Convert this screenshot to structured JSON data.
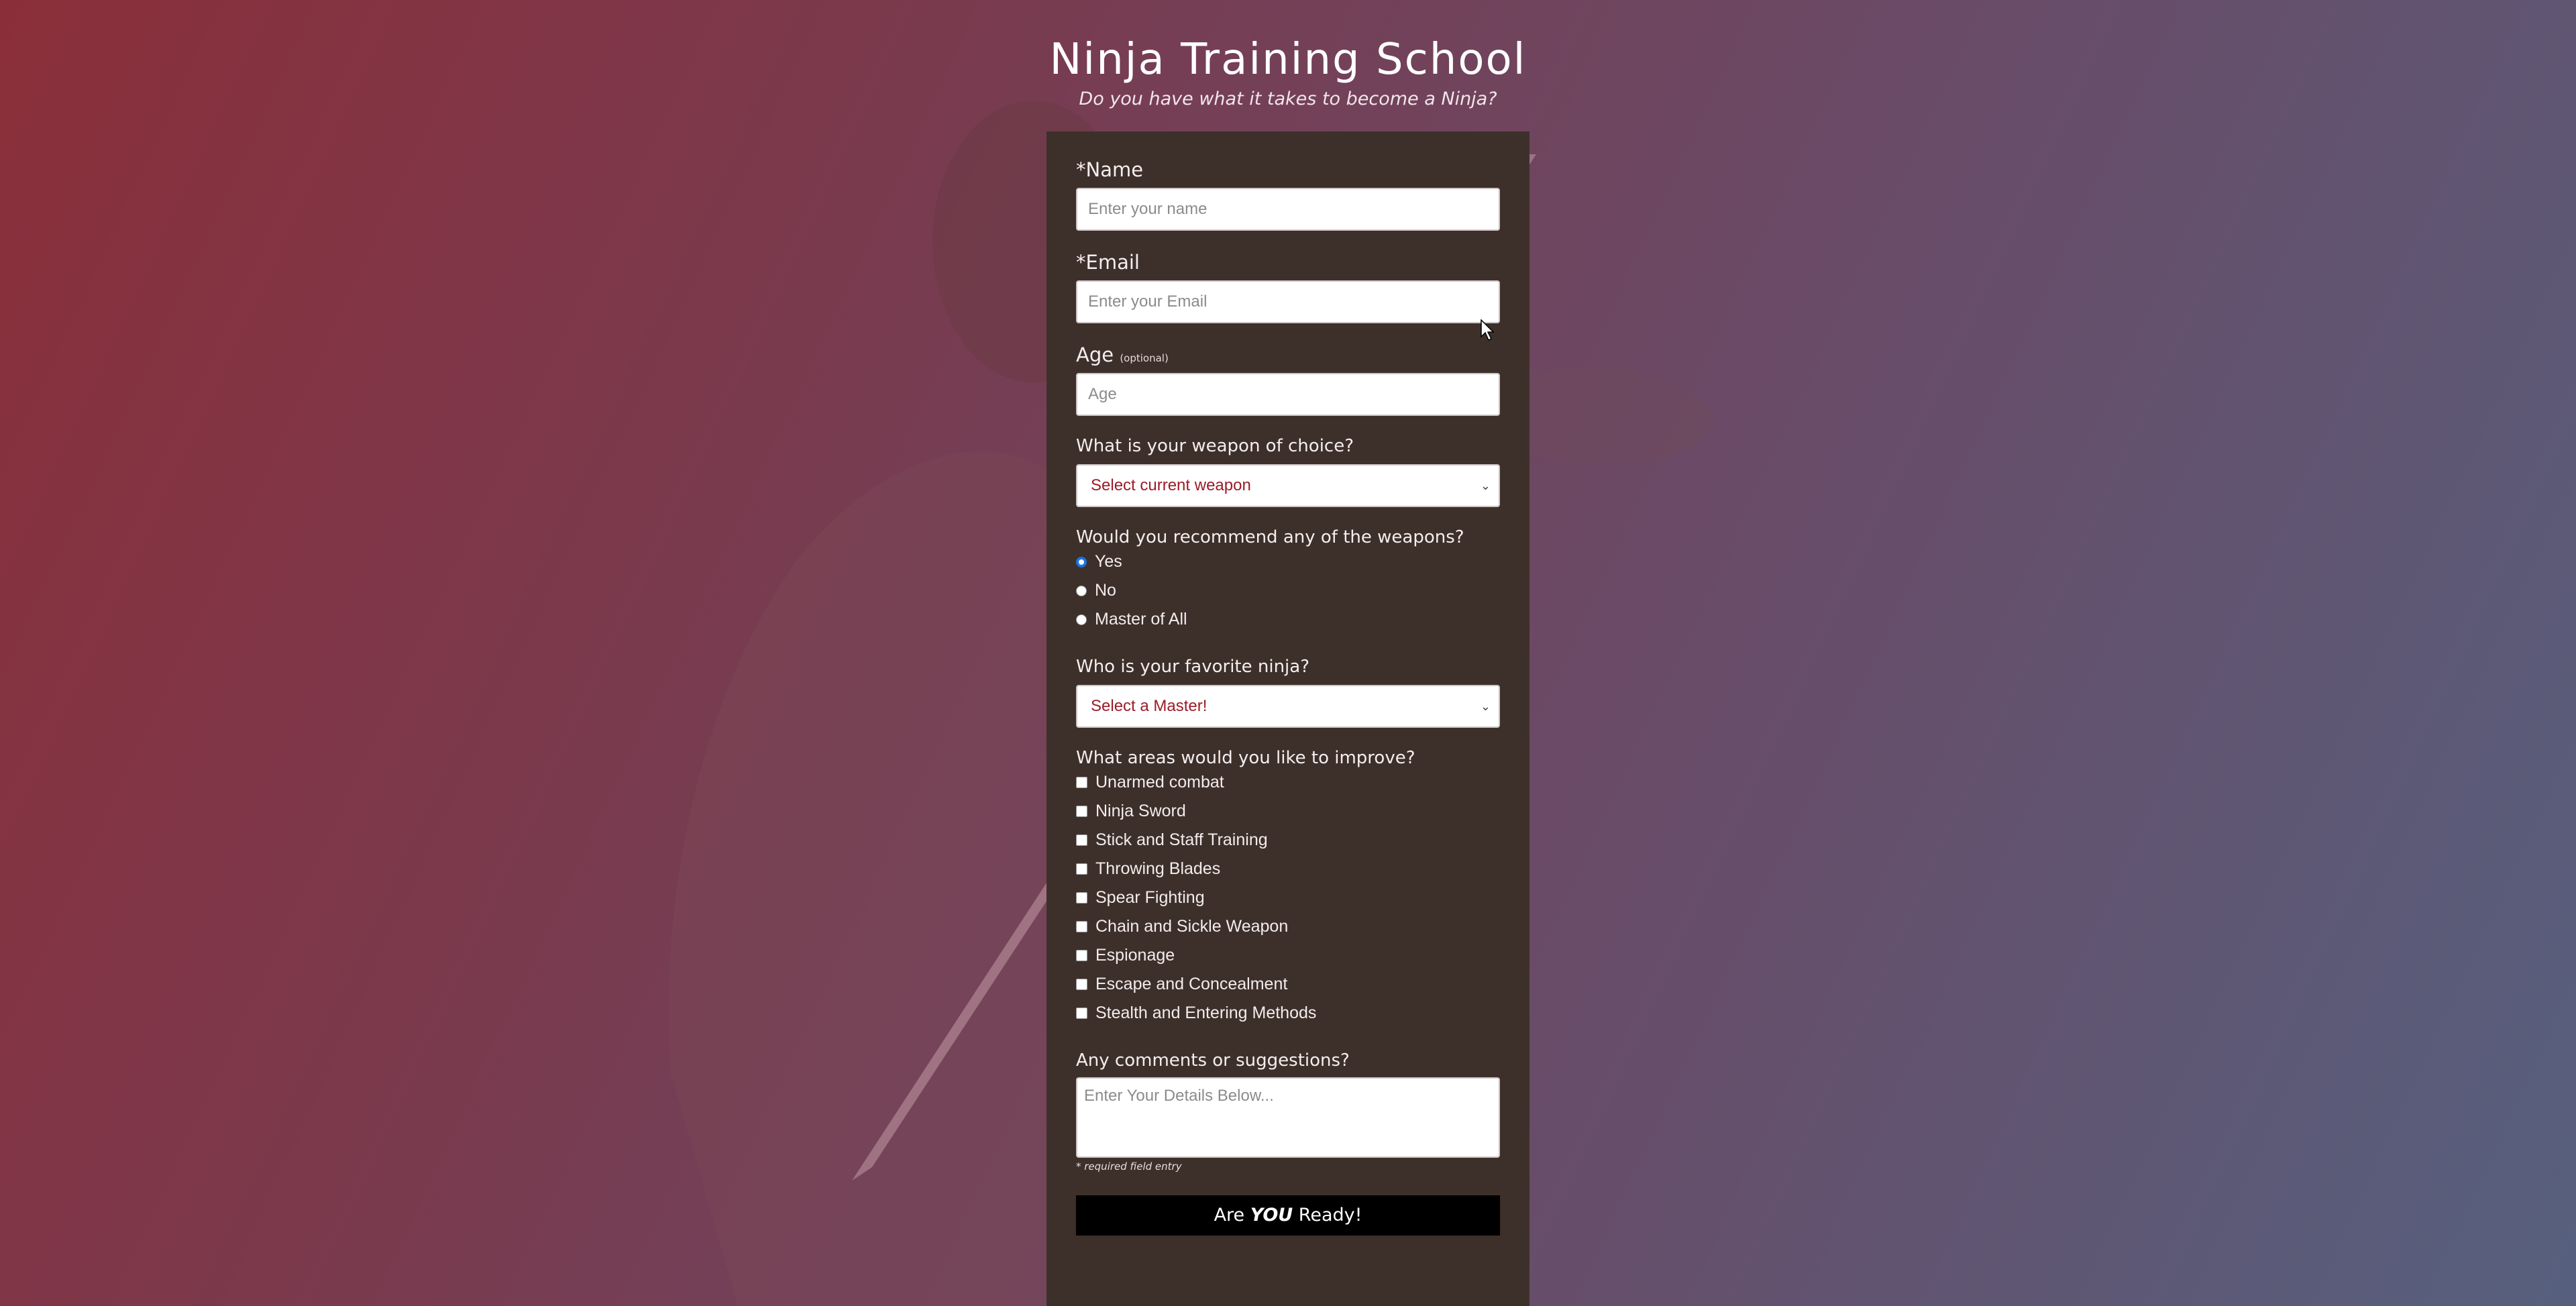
{
  "header": {
    "title": "Ninja Training School",
    "subtitle": "Do you have what it takes to become a Ninja?"
  },
  "form": {
    "name": {
      "label": "*Name",
      "placeholder": "Enter your name"
    },
    "email": {
      "label": "*Email",
      "placeholder": "Enter your Email"
    },
    "age": {
      "label": "Age",
      "optional": "(optional)",
      "placeholder": "Age"
    },
    "weapon": {
      "label": "What is your weapon of choice?",
      "selected": "Select current weapon"
    },
    "recommend": {
      "label": "Would you recommend any of the weapons?",
      "options": [
        "Yes",
        "No",
        "Master of All"
      ],
      "checked_index": 0
    },
    "favorite": {
      "label": "Who is your favorite ninja?",
      "selected": "Select a Master!"
    },
    "improve": {
      "label": "What areas would you like to improve?",
      "options": [
        "Unarmed combat",
        "Ninja Sword",
        "Stick and Staff Training",
        "Throwing Blades",
        "Spear Fighting",
        "Chain and Sickle Weapon",
        "Espionage",
        "Escape and Concealment",
        "Stealth and Entering Methods"
      ]
    },
    "comments": {
      "label": "Any comments or suggestions?",
      "placeholder": "Enter Your Details Below..."
    },
    "required_note": "* required field entry",
    "submit": {
      "prefix": "Are ",
      "emphasis": "YOU",
      "suffix": " Ready!"
    }
  },
  "colors": {
    "panel": "#3d302b",
    "select_text": "#9b1b27",
    "radio_accent": "#1a73e8",
    "button_bg": "#000000"
  }
}
